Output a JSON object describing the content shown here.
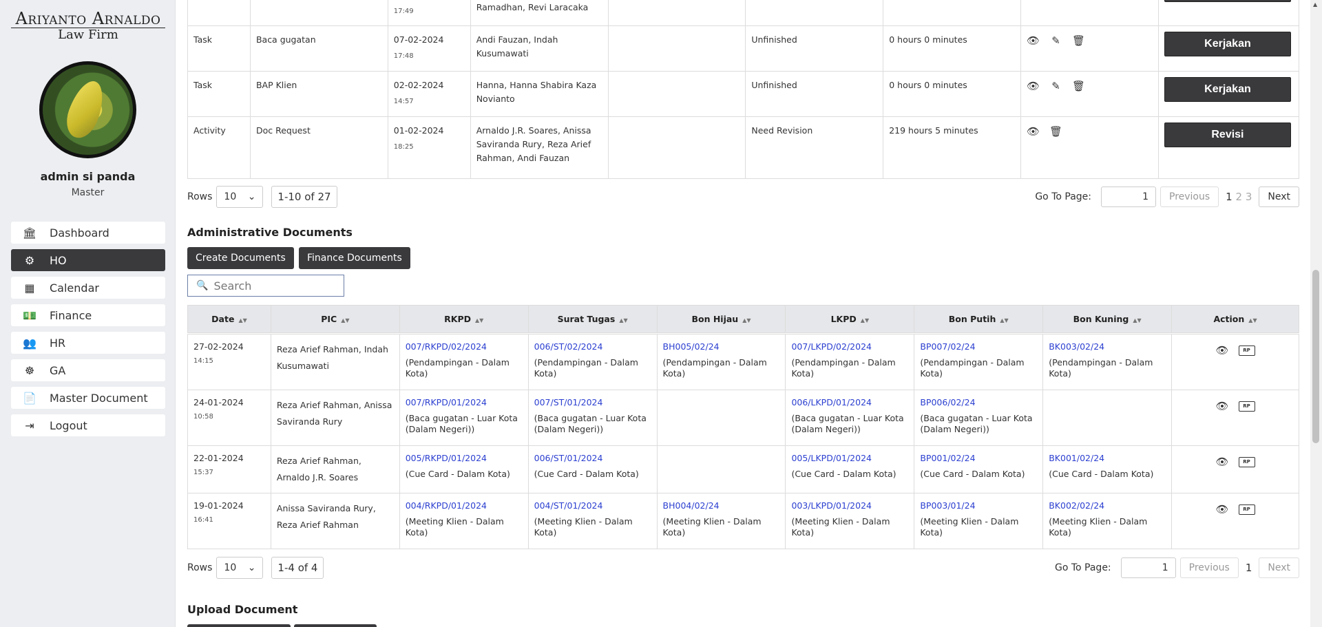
{
  "sidebar": {
    "logo_line1": "Ariyanto Arnaldo",
    "logo_line2": "Law Firm",
    "user_name": "admin si panda",
    "user_role": "Master",
    "items": [
      {
        "label": "Dashboard",
        "icon": "bank-icon"
      },
      {
        "label": "HO",
        "icon": "people-settings-icon"
      },
      {
        "label": "Calendar",
        "icon": "calendar-icon"
      },
      {
        "label": "Finance",
        "icon": "money-icon"
      },
      {
        "label": "HR",
        "icon": "team-icon"
      },
      {
        "label": "GA",
        "icon": "gear-head-icon"
      },
      {
        "label": "Master Document",
        "icon": "document-icon"
      },
      {
        "label": "Logout",
        "icon": "logout-icon"
      }
    ]
  },
  "tasks": {
    "rows": [
      {
        "type": "",
        "title": "",
        "date": "",
        "time": "17:49",
        "pic": "Ramadhan, Revi Laracaka",
        "status": "",
        "duration": "",
        "button": ""
      },
      {
        "type": "Task",
        "title": "Baca gugatan",
        "date": "07-02-2024",
        "time": "17:48",
        "pic": "Andi Fauzan, Indah Kusumawati",
        "status": "Unfinished",
        "duration": "0 hours 0 minutes",
        "button": "Kerjakan"
      },
      {
        "type": "Task",
        "title": "BAP Klien",
        "date": "02-02-2024",
        "time": "14:57",
        "pic": "Hanna, Hanna Shabira Kaza Novianto",
        "status": "Unfinished",
        "duration": "0 hours 0 minutes",
        "button": "Kerjakan"
      },
      {
        "type": "Activity",
        "title": "Doc Request",
        "date": "01-02-2024",
        "time": "18:25",
        "pic": "Arnaldo J.R. Soares, Anissa Saviranda Rury, Reza Arief Rahman, Andi Fauzan",
        "status": "Need Revision",
        "duration": "219 hours 5 minutes",
        "button": "Revisi"
      }
    ],
    "pager": {
      "rows_label": "Rows",
      "rows_value": "10",
      "count": "1-10 of 27",
      "goto_label": "Go To Page:",
      "goto_value": "1",
      "previous": "Previous",
      "page_current": "1",
      "page_2": "2",
      "page_3": "3",
      "next": "Next"
    }
  },
  "admin_docs": {
    "title": "Administrative Documents",
    "create_button": "Create Documents",
    "finance_button": "Finance Documents",
    "search_placeholder": "Search",
    "headers": [
      "Date",
      "PIC",
      "RKPD",
      "Surat Tugas",
      "Bon Hijau",
      "LKPD",
      "Bon Putih",
      "Bon Kuning",
      "Action"
    ],
    "rows": [
      {
        "date": "27-02-2024",
        "time": "14:15",
        "pic": "Reza Arief Rahman, Indah Kusumawati",
        "rkpd": {
          "code": "007/RKPD/02/2024",
          "desc": "(Pendampingan - Dalam Kota)"
        },
        "st": {
          "code": "006/ST/02/2024",
          "desc": "(Pendampingan - Dalam Kota)"
        },
        "bh": {
          "code": "BH005/02/24",
          "desc": "(Pendampingan - Dalam Kota)"
        },
        "lkpd": {
          "code": "007/LKPD/02/2024",
          "desc": "(Pendampingan - Dalam Kota)"
        },
        "bp": {
          "code": "BP007/02/24",
          "desc": "(Pendampingan - Dalam Kota)"
        },
        "bk": {
          "code": "BK003/02/24",
          "desc": "(Pendampingan - Dalam Kota)"
        }
      },
      {
        "date": "24-01-2024",
        "time": "10:58",
        "pic": "Reza Arief Rahman, Anissa Saviranda Rury",
        "rkpd": {
          "code": "007/RKPD/01/2024",
          "desc": "(Baca gugatan - Luar Kota (Dalam Negeri))"
        },
        "st": {
          "code": "007/ST/01/2024",
          "desc": "(Baca gugatan - Luar Kota (Dalam Negeri))"
        },
        "bh": {
          "code": "",
          "desc": ""
        },
        "lkpd": {
          "code": "006/LKPD/01/2024",
          "desc": "(Baca gugatan - Luar Kota (Dalam Negeri))"
        },
        "bp": {
          "code": "BP006/02/24",
          "desc": "(Baca gugatan - Luar Kota (Dalam Negeri))"
        },
        "bk": {
          "code": "",
          "desc": ""
        }
      },
      {
        "date": "22-01-2024",
        "time": "15:37",
        "pic": "Reza Arief Rahman, Arnaldo J.R. Soares",
        "rkpd": {
          "code": "005/RKPD/01/2024",
          "desc": "(Cue Card - Dalam Kota)"
        },
        "st": {
          "code": "006/ST/01/2024",
          "desc": "(Cue Card - Dalam Kota)"
        },
        "bh": {
          "code": "",
          "desc": ""
        },
        "lkpd": {
          "code": "005/LKPD/01/2024",
          "desc": "(Cue Card - Dalam Kota)"
        },
        "bp": {
          "code": "BP001/02/24",
          "desc": "(Cue Card - Dalam Kota)"
        },
        "bk": {
          "code": "BK001/02/24",
          "desc": "(Cue Card - Dalam Kota)"
        }
      },
      {
        "date": "19-01-2024",
        "time": "16:41",
        "pic": "Anissa Saviranda Rury, Reza Arief Rahman",
        "rkpd": {
          "code": "004/RKPD/01/2024",
          "desc": "(Meeting Klien - Dalam Kota)"
        },
        "st": {
          "code": "004/ST/01/2024",
          "desc": "(Meeting Klien - Dalam Kota)"
        },
        "bh": {
          "code": "BH004/02/24",
          "desc": "(Meeting Klien - Dalam Kota)"
        },
        "lkpd": {
          "code": "003/LKPD/01/2024",
          "desc": "(Meeting Klien - Dalam Kota)"
        },
        "bp": {
          "code": "BP003/01/24",
          "desc": "(Meeting Klien - Dalam Kota)"
        },
        "bk": {
          "code": "BK002/02/24",
          "desc": "(Meeting Klien - Dalam Kota)"
        }
      }
    ],
    "pager": {
      "rows_label": "Rows",
      "rows_value": "10",
      "count": "1-4 of 4",
      "goto_label": "Go To Page:",
      "goto_value": "1",
      "previous": "Previous",
      "page_current": "1",
      "next": "Next"
    }
  },
  "upload": {
    "title": "Upload Document"
  },
  "colors": {
    "dark_button": "#3a3a3d",
    "link": "#2b3fd0",
    "sidebar_bg": "#eceef1"
  }
}
